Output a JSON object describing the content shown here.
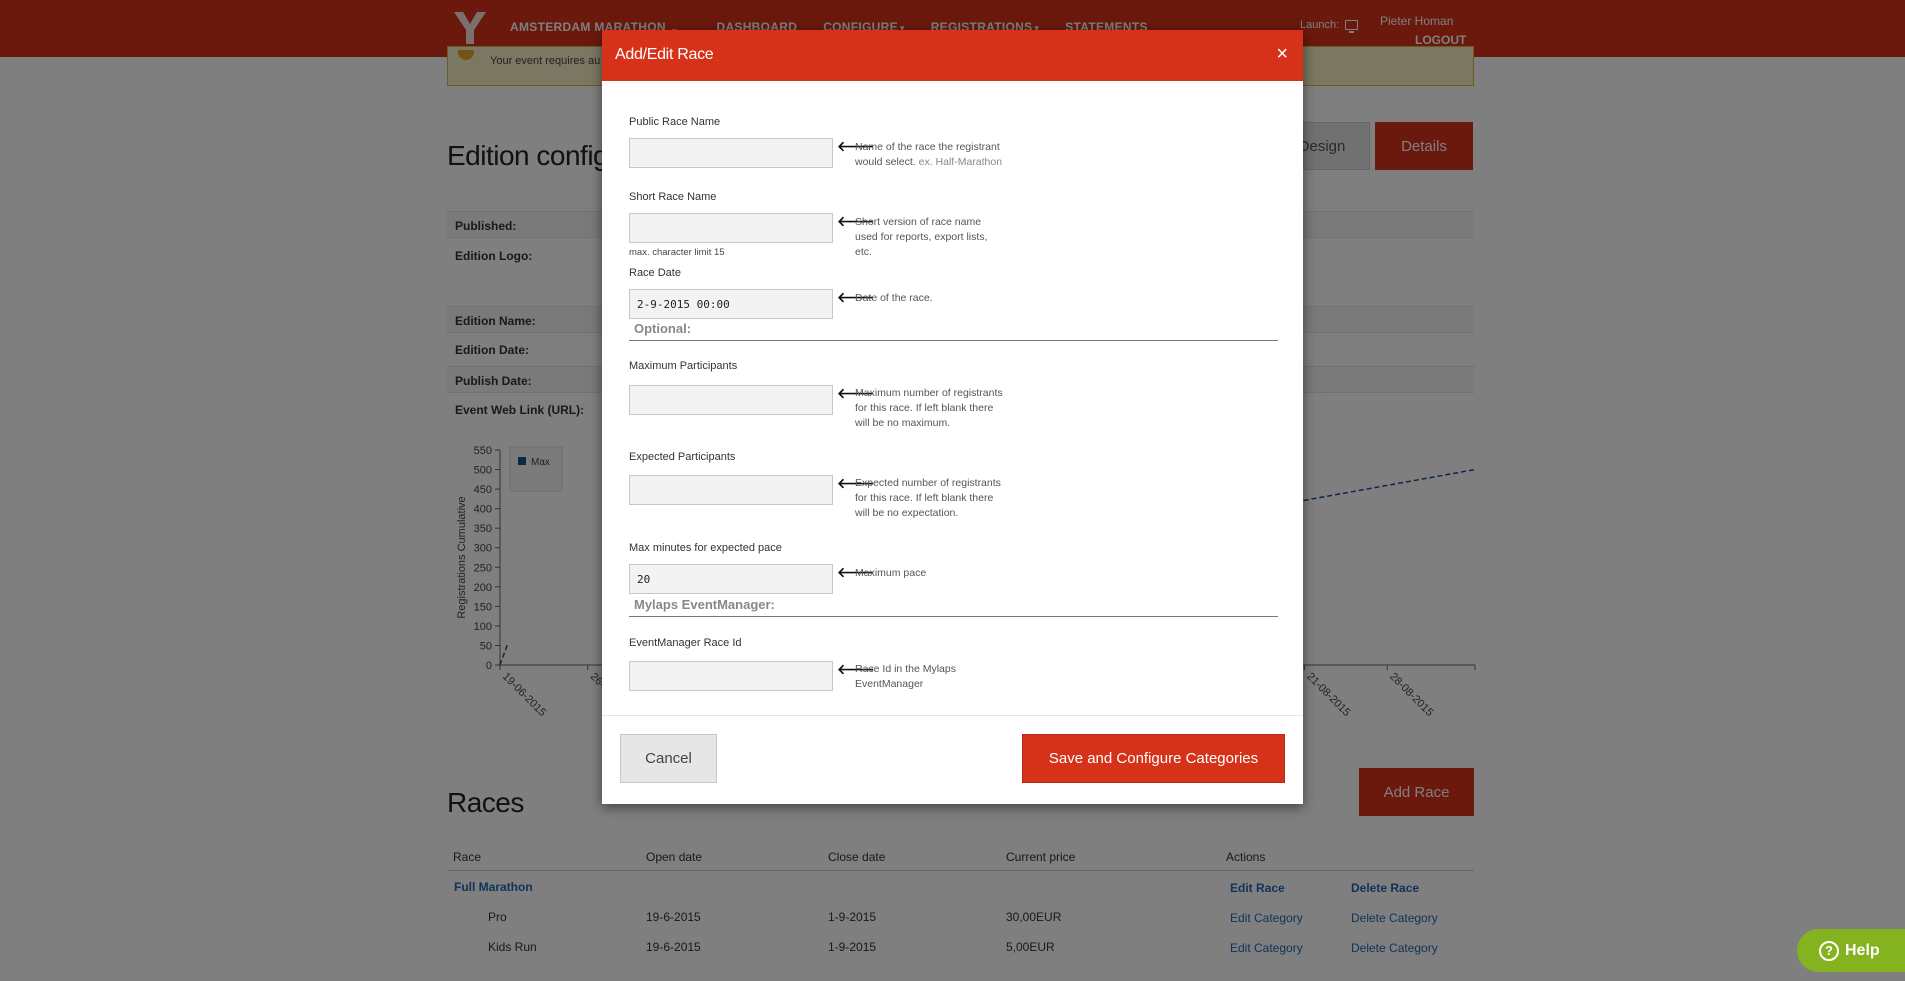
{
  "topbar": {
    "event_menu": "AMSTERDAM MARATHON",
    "nav": [
      "DASHBOARD",
      "CONFIGURE",
      "REGISTRATIONS",
      "STATEMENTS"
    ],
    "launch_label": "Launch:",
    "user_name": "Pieter Homan",
    "logout": "LOGOUT"
  },
  "alert": {
    "text": "Your event requires au"
  },
  "page": {
    "heading": "Edition config",
    "design_button": "Design",
    "details_button": "Details",
    "fields": [
      "Published:",
      "Edition Logo:",
      "Edition Name:",
      "Edition Date:",
      "Publish Date:",
      "Event Web Link (URL):"
    ]
  },
  "chart_data": {
    "type": "line",
    "ylabel": "Registrations Cumulative",
    "ylim": [
      0,
      550
    ],
    "yticks": [
      0,
      50,
      100,
      150,
      200,
      250,
      300,
      350,
      400,
      450,
      500,
      550
    ],
    "xticks": [
      "19-06-2015",
      "26-...",
      "21-08-2015",
      "28-08-2015"
    ],
    "series": [
      {
        "name": "Max",
        "style": "dashed",
        "color": "#1f4e8c",
        "points_visible": [
          [
            0,
            0
          ],
          [
            8,
            55
          ],
          [
            800,
            410
          ],
          [
            1000,
            500
          ]
        ]
      }
    ]
  },
  "races": {
    "heading": "Races",
    "add_race_button": "Add Race",
    "columns": [
      "Race",
      "Open date",
      "Close date",
      "Current price",
      "Actions"
    ],
    "race": {
      "name": "Full Marathon",
      "edit": "Edit Race",
      "delete": "Delete Race"
    },
    "categories": [
      {
        "name": "Pro",
        "open": "19-6-2015",
        "close": "1-9-2015",
        "price": "30,00EUR",
        "edit": "Edit Category",
        "delete": "Delete Category"
      },
      {
        "name": "Kids Run",
        "open": "19-6-2015",
        "close": "1-9-2015",
        "price": "5,00EUR",
        "edit": "Edit Category",
        "delete": "Delete Category"
      }
    ]
  },
  "help": {
    "label": "Help"
  },
  "modal": {
    "title": "Add/Edit Race",
    "close_symbol": "×",
    "public_race_name": {
      "label": "Public Race Name",
      "value": "",
      "help": "Name of the race the registrant would select.",
      "example": "ex. Half-Marathon"
    },
    "short_race_name": {
      "label": "Short Race Name",
      "value": "",
      "help": "Short version of race name used for reports, export lists, etc.",
      "sub": "max. character limit 15"
    },
    "race_date": {
      "label": "Race Date",
      "value": "2-9-2015 00:00",
      "help": "Date of the race."
    },
    "optional_section": "Optional:",
    "max_participants": {
      "label": "Maximum Participants",
      "value": "",
      "help": "Maximum number of registrants for this race. If left blank there will be no maximum."
    },
    "expected_participants": {
      "label": "Expected Participants",
      "value": "",
      "help": "Expected number of registrants for this race. If left blank there will be no expectation."
    },
    "max_minutes_pace": {
      "label": "Max minutes for expected pace",
      "value": "20",
      "help": "Maximum pace"
    },
    "mylaps_section": "Mylaps EventManager:",
    "eventmanager_race_id": {
      "label": "EventManager Race Id",
      "value": "",
      "help": "Race Id in the Mylaps EventManager"
    },
    "cancel_button": "Cancel",
    "save_button": "Save and Configure Categories"
  }
}
